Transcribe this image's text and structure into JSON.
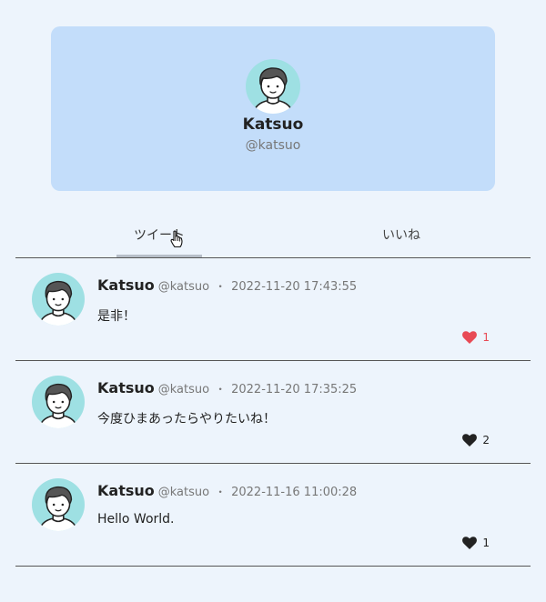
{
  "profile": {
    "name": "Katsuo",
    "handle": "@katsuo"
  },
  "tabs": [
    {
      "label": "ツイート",
      "active": true
    },
    {
      "label": "いいね",
      "active": false
    }
  ],
  "tweets": [
    {
      "name": "Katsuo",
      "handle": "@katsuo",
      "separator": "・",
      "time": "2022-11-20 17:43:55",
      "text": "是非！",
      "likes": "1",
      "liked": true
    },
    {
      "name": "Katsuo",
      "handle": "@katsuo",
      "separator": "・",
      "time": "2022-11-20 17:35:25",
      "text": "今度ひまあったらやりたいね！",
      "likes": "2",
      "liked": false
    },
    {
      "name": "Katsuo",
      "handle": "@katsuo",
      "separator": "・",
      "time": "2022-11-16 11:00:28",
      "text": "Hello World.",
      "likes": "1",
      "liked": false
    }
  ],
  "colors": {
    "background": "#edf4fc",
    "card": "#c3ddfa",
    "avatar_bg": "#9ee0e3",
    "liked": "#e84a55"
  }
}
